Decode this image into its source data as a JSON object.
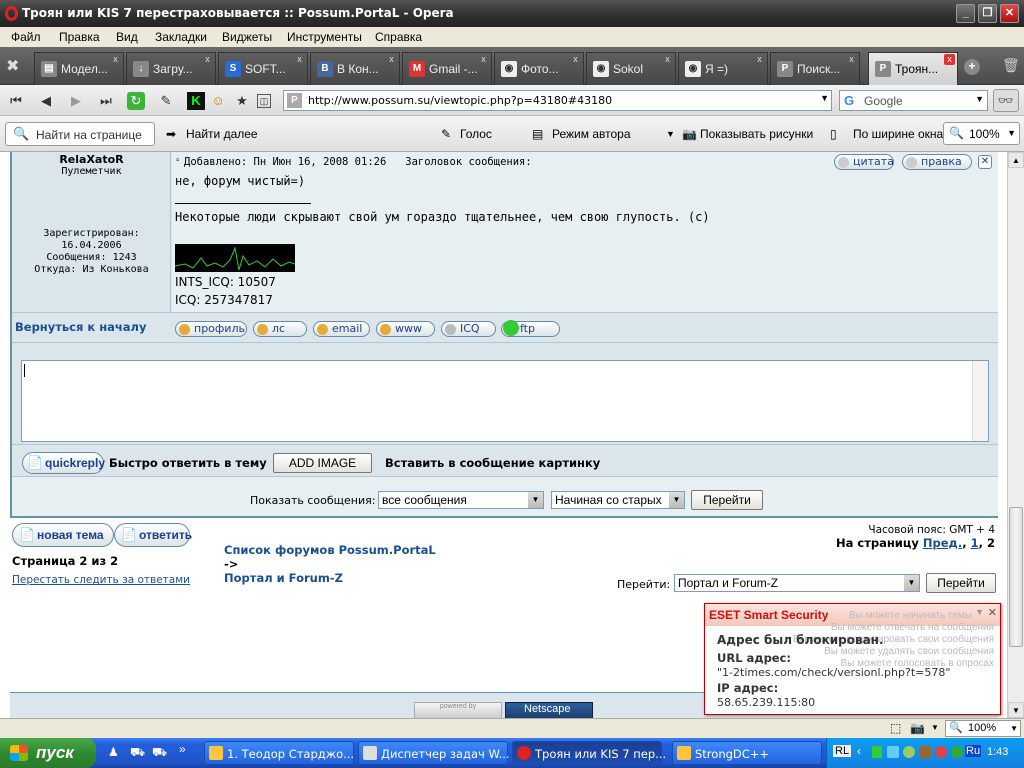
{
  "window": {
    "title": "Троян или KIS 7 перестраховывается :: Possum.PortaL - Opera"
  },
  "menu": [
    "Файл",
    "Правка",
    "Вид",
    "Закладки",
    "Виджеты",
    "Инструменты",
    "Справка"
  ],
  "tabs": [
    {
      "label": "Модел...",
      "icon": "doc-icon"
    },
    {
      "label": "Загру...",
      "icon": "download-icon"
    },
    {
      "label": "SOFT...",
      "icon": "s-icon"
    },
    {
      "label": "В Кон...",
      "icon": "vk-icon"
    },
    {
      "label": "Gmail -...",
      "icon": "gmail-icon"
    },
    {
      "label": "Фото...",
      "icon": "possum-icon"
    },
    {
      "label": "Sokol",
      "icon": "possum-icon"
    },
    {
      "label": "Я =)",
      "icon": "possum-icon"
    },
    {
      "label": "Поиск...",
      "icon": "p-icon"
    },
    {
      "label": "Троян...",
      "icon": "p-icon"
    }
  ],
  "address": {
    "url": "http://www.possum.su/viewtopic.php?p=43180#43180",
    "page_icon": "P"
  },
  "search": {
    "engine": "Google"
  },
  "findbar": {
    "placeholder": "Найти на странице",
    "find_next": "Найти далее",
    "voice": "Голос",
    "author_mode": "Режим автора",
    "show_images": "Показывать рисунки",
    "fit_width": "По ширине окна",
    "zoom": "100%"
  },
  "post": {
    "author": "RelaXatoR",
    "rank": "Пулеметчик",
    "registered_label": "Зарегистрирован:",
    "registered_date": "16.04.2006",
    "posts": "Сообщения: 1243",
    "from": "Откуда: Из Конькова",
    "meta": "Добавлено: Пн Июн 16, 2008 01:26   Заголовок сообщения:",
    "quote_btn": "цитата",
    "edit_btn": "правка",
    "text": "не, форум чистый=)",
    "signature_line1": "Некоторые люди скрывают свой ум гораздо тщательнее, чем свою глупость. (с)",
    "sig_icq": "INTS_ICQ: 10507",
    "icq": "ICQ: 257347817",
    "back_to_top": "Вернуться к началу",
    "buttons": [
      "профиль",
      "лс",
      "email",
      "www",
      "ICQ",
      "ftp"
    ]
  },
  "reply": {
    "quickreply_btn": "quickreply",
    "quick_label": "Быстро ответить в тему",
    "add_image": "ADD IMAGE",
    "insert_image": "Вставить в сообщение картинку"
  },
  "show": {
    "label": "Показать сообщения:",
    "filter": "все сообщения",
    "order": "Начиная со старых",
    "go": "Перейти"
  },
  "footer": {
    "new_topic": "новая тема",
    "reply": "ответить",
    "breadcrumb_root": "Список форумов Possum.PortaL",
    "breadcrumb_sep": "->",
    "breadcrumb_forum": "Портал и Forum-Z",
    "timezone": "Часовой пояс: GMT + 4",
    "pages_label": "На страницу",
    "prev": "Пред.",
    "page1": "1",
    "page2": "2",
    "page_of": "Страница 2 из 2",
    "unwatch": "Перестать следить за ответами",
    "jump_label": "Перейти:",
    "jump_value": "Портал и Forum-Z",
    "jump_go": "Перейти",
    "powered": "powered by",
    "netscape": "Netscape"
  },
  "eset": {
    "title": "ESET Smart Security",
    "blocked": "Адрес был блокирован.",
    "url_label": "URL адрес:",
    "url": "\"1-2times.com/check/versionl.php?t=578\"",
    "ip_label": "IP адрес:",
    "ip": "58.65.239.115:80",
    "ghost": [
      "Вы можете начинать темы",
      "Вы можете отвечать на сообщения",
      "Вы можете редактировать свои сообщения",
      "Вы можете удалять свои сообщения",
      "Вы можете голосовать в опросах"
    ]
  },
  "statusbar": {
    "zoom": "100%"
  },
  "taskbar": {
    "start": "пуск",
    "items": [
      "1. Теодор Старджо...",
      "Диспетчер задач W...",
      "Троян или KIS 7 пер...",
      "StrongDC++"
    ],
    "lang": "RL",
    "clock": "1:43",
    "lang2": "Ru"
  }
}
